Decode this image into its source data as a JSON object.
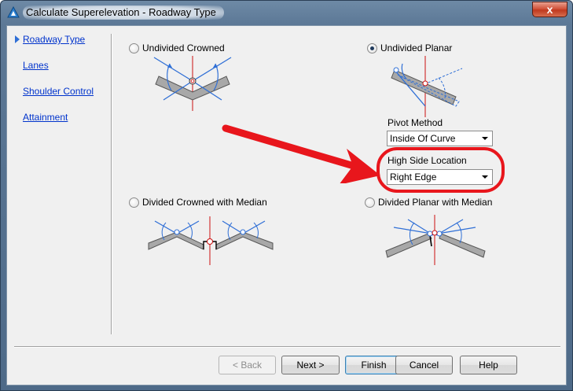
{
  "window": {
    "title": "Calculate Superelevation - Roadway Type",
    "close_glyph": "x",
    "icon": "civil3d-app-icon"
  },
  "nav": {
    "items": [
      {
        "label": "Roadway Type",
        "active": true
      },
      {
        "label": "Lanes",
        "active": false
      },
      {
        "label": "Shoulder Control",
        "active": false
      },
      {
        "label": "Attainment",
        "active": false
      }
    ]
  },
  "options": {
    "undivided_crowned": {
      "label": "Undivided Crowned",
      "selected": false
    },
    "undivided_planar": {
      "label": "Undivided Planar",
      "selected": true
    },
    "divided_crowned_median": {
      "label": "Divided Crowned with Median",
      "selected": false
    },
    "divided_planar_median": {
      "label": "Divided Planar with Median",
      "selected": false
    }
  },
  "pivot_method": {
    "label": "Pivot Method",
    "value": "Inside Of Curve"
  },
  "high_side_location": {
    "label": "High Side Location",
    "value": "Right Edge"
  },
  "annotation": {
    "color": "#e8161c"
  },
  "buttons": {
    "back": "< Back",
    "next": "Next >",
    "finish": "Finish",
    "cancel": "Cancel",
    "help": "Help"
  }
}
